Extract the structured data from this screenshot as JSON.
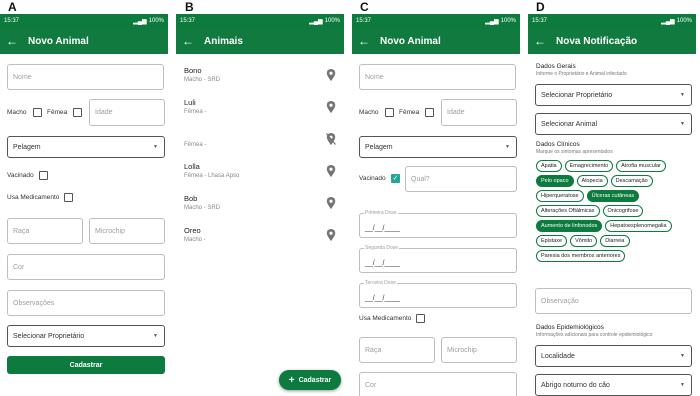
{
  "panels": {
    "a": {
      "letter": "A",
      "time": "15:37",
      "battery": "100%",
      "title": "Novo Animal",
      "nome_placeholder": "Nome",
      "macho": "Macho",
      "femea": "Fêmea",
      "idade_placeholder": "Idade",
      "pelagem": "Pelagem",
      "vacinado": "Vacinado",
      "usa_medicamento": "Usa Medicamento",
      "raca_placeholder": "Raça",
      "microchip_placeholder": "Microchip",
      "cor_placeholder": "Cor",
      "observacoes_placeholder": "Observações",
      "proprietario": "Selecionar Proprietário",
      "cadastrar": "Cadastrar"
    },
    "b": {
      "letter": "B",
      "time": "15:37",
      "battery": "100%",
      "title": "Animais",
      "items": [
        {
          "name": "Bono",
          "sub": "Macho - SRD",
          "pin": "location-pin"
        },
        {
          "name": "Luli",
          "sub": "Fêmea -",
          "pin": "location-pin"
        },
        {
          "name": "",
          "sub": "Fêmea -",
          "pin": "location-off"
        },
        {
          "name": "Lolla",
          "sub": "Fêmea - Lhasa Apso",
          "pin": "location-pin"
        },
        {
          "name": "Bob",
          "sub": "Macho - SRD",
          "pin": "location-pin"
        },
        {
          "name": "Oreo",
          "sub": "Macho -",
          "pin": "location-pin"
        }
      ],
      "fab": "Cadastrar"
    },
    "c": {
      "letter": "C",
      "time": "15:37",
      "battery": "100%",
      "title": "Novo Animal",
      "nome_placeholder": "Nome",
      "macho": "Macho",
      "femea": "Fêmea",
      "idade_placeholder": "Idade",
      "pelagem": "Pelagem",
      "vacinado": "Vacinado",
      "qual_placeholder": "Qual?",
      "primeira_dose": "Primeira Dose",
      "segunda_dose": "Segunda Dose",
      "terceira_dose": "Terceira Dose",
      "date_placeholder": "__/__/____",
      "usa_medicamento": "Usa Medicamento",
      "raca_placeholder": "Raça",
      "microchip_placeholder": "Microchip",
      "cor_placeholder": "Cor"
    },
    "d": {
      "letter": "D",
      "time": "15:37",
      "battery": "100%",
      "title": "Nova Notificação",
      "dados_gerais": "Dados Gerais",
      "dados_gerais_sub": "Informe o Proprietário e Animal infectado",
      "sel_proprietario": "Selecionar Proprietário",
      "sel_animal": "Selecionar Animal",
      "dados_clinicos": "Dados Clínicos",
      "dados_clinicos_sub": "Marque os sintomas apresentados",
      "chips": [
        {
          "label": "Apatia",
          "selected": false
        },
        {
          "label": "Emagrecimento",
          "selected": false
        },
        {
          "label": "Atrofia muscular",
          "selected": false
        },
        {
          "label": "Pelo opaco",
          "selected": true
        },
        {
          "label": "Alopecia",
          "selected": false
        },
        {
          "label": "Descamação",
          "selected": false
        },
        {
          "label": "Hiperqueratose",
          "selected": false
        },
        {
          "label": "Úlceras cutâneas",
          "selected": true
        },
        {
          "label": "Alterações Oftálmicas",
          "selected": false
        },
        {
          "label": "Onicogrifose",
          "selected": false
        },
        {
          "label": "Aumento de linfonodos",
          "selected": true
        },
        {
          "label": "Hepatoesplenomegalia",
          "selected": false
        },
        {
          "label": "Epistaxe",
          "selected": false
        },
        {
          "label": "Vômito",
          "selected": false
        },
        {
          "label": "Diarreia",
          "selected": false
        },
        {
          "label": "Paresia dos membros anteriores",
          "selected": false
        }
      ],
      "observacao_placeholder": "Observação",
      "dados_epi": "Dados Epidemiológicos",
      "dados_epi_sub": "Informações adicionais para controle epidemiológico",
      "localidade": "Localidade",
      "abrigo": "Abrigo noturno do cão"
    }
  }
}
